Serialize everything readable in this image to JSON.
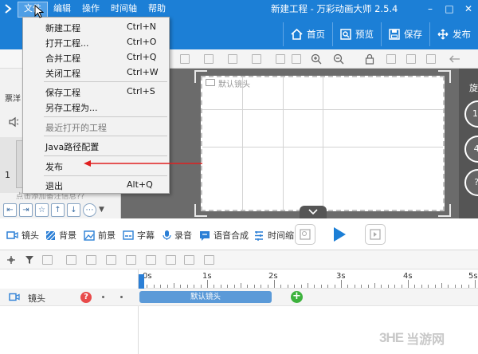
{
  "app": {
    "window_title": "新建工程 - 万彩动画大师 2.5.4",
    "accent_color": "#1c7fd6"
  },
  "menubar": {
    "items": [
      "文件",
      "编辑",
      "操作",
      "时间轴",
      "帮助"
    ]
  },
  "toolbar": {
    "home_label": "首页",
    "preview_label": "预览",
    "save_label": "保存",
    "publish_label": "发布"
  },
  "file_menu": {
    "items": [
      {
        "label": "新建工程",
        "shortcut": "Ctrl+N"
      },
      {
        "label": "打开工程...",
        "shortcut": "Ctrl+O"
      },
      {
        "label": "合并工程",
        "shortcut": "Ctrl+Q"
      },
      {
        "label": "关闭工程",
        "shortcut": "Ctrl+W"
      },
      {
        "label": "保存工程",
        "shortcut": "Ctrl+S"
      },
      {
        "label": "另存工程为...",
        "shortcut": ""
      },
      {
        "label": "最近打开的工程",
        "shortcut": ""
      },
      {
        "label": "Java路径配置",
        "shortcut": ""
      },
      {
        "label": "发布",
        "shortcut": ""
      },
      {
        "label": "退出",
        "shortcut": "Alt+Q"
      }
    ]
  },
  "left_panel": {
    "label_fragment": "票洋",
    "track_number": "1",
    "hint_fragment": "点击添加备注信息??"
  },
  "stage": {
    "camera_label": "默认镜头",
    "rotate_label": "旋",
    "zoom_buttons": [
      "16",
      "4:",
      "?:"
    ]
  },
  "element_toolbar": {
    "items": [
      {
        "label": "镜头",
        "icon": "camera-icon"
      },
      {
        "label": "背景",
        "icon": "background-icon"
      },
      {
        "label": "前景",
        "icon": "foreground-icon"
      },
      {
        "label": "字幕",
        "icon": "subtitle-icon"
      },
      {
        "label": "录音",
        "icon": "microphone-icon"
      },
      {
        "label": "语音合成",
        "icon": "speech-synthesis-icon"
      },
      {
        "label": "时间缩",
        "icon": "time-scale-icon"
      }
    ]
  },
  "timeline": {
    "ruler_labels": [
      "0s",
      "1s",
      "2s",
      "3s",
      "4s",
      "5s"
    ],
    "track_name": "镜头",
    "help_symbol": "?",
    "clip_label": "默认镜头",
    "add_symbol": "+"
  },
  "watermark": {
    "logo": "3HE",
    "text": "当游网"
  }
}
